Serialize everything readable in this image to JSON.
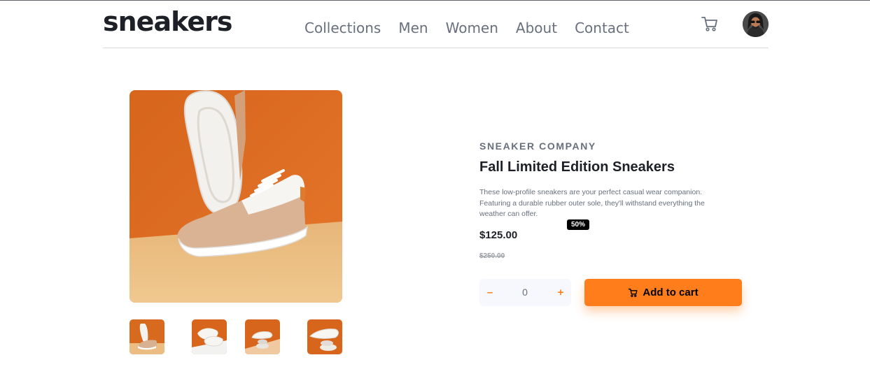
{
  "brand": {
    "logo_text": "sneakers"
  },
  "nav": {
    "items": [
      "Collections",
      "Men",
      "Women",
      "About",
      "Contact"
    ]
  },
  "icons": {
    "cart": "cart-icon",
    "avatar": "user-avatar"
  },
  "product": {
    "company": "SNEAKER COMPANY",
    "title": "Fall Limited Edition Sneakers",
    "description": "These low-profile sneakers are your perfect casual wear companion. Featuring a durable rubber outer sole, they'll withstand everything the weather can offer.",
    "price": "$125.00",
    "discount": "50%",
    "original_price": "$250.00"
  },
  "quantity": {
    "minus_label": "–",
    "value": "0",
    "plus_label": "+"
  },
  "add_to_cart": {
    "label": "Add to cart"
  },
  "colors": {
    "accent": "#ff7d1a",
    "background": "#ffffff",
    "text_dark": "#1d2026",
    "text_muted": "#68707d"
  }
}
